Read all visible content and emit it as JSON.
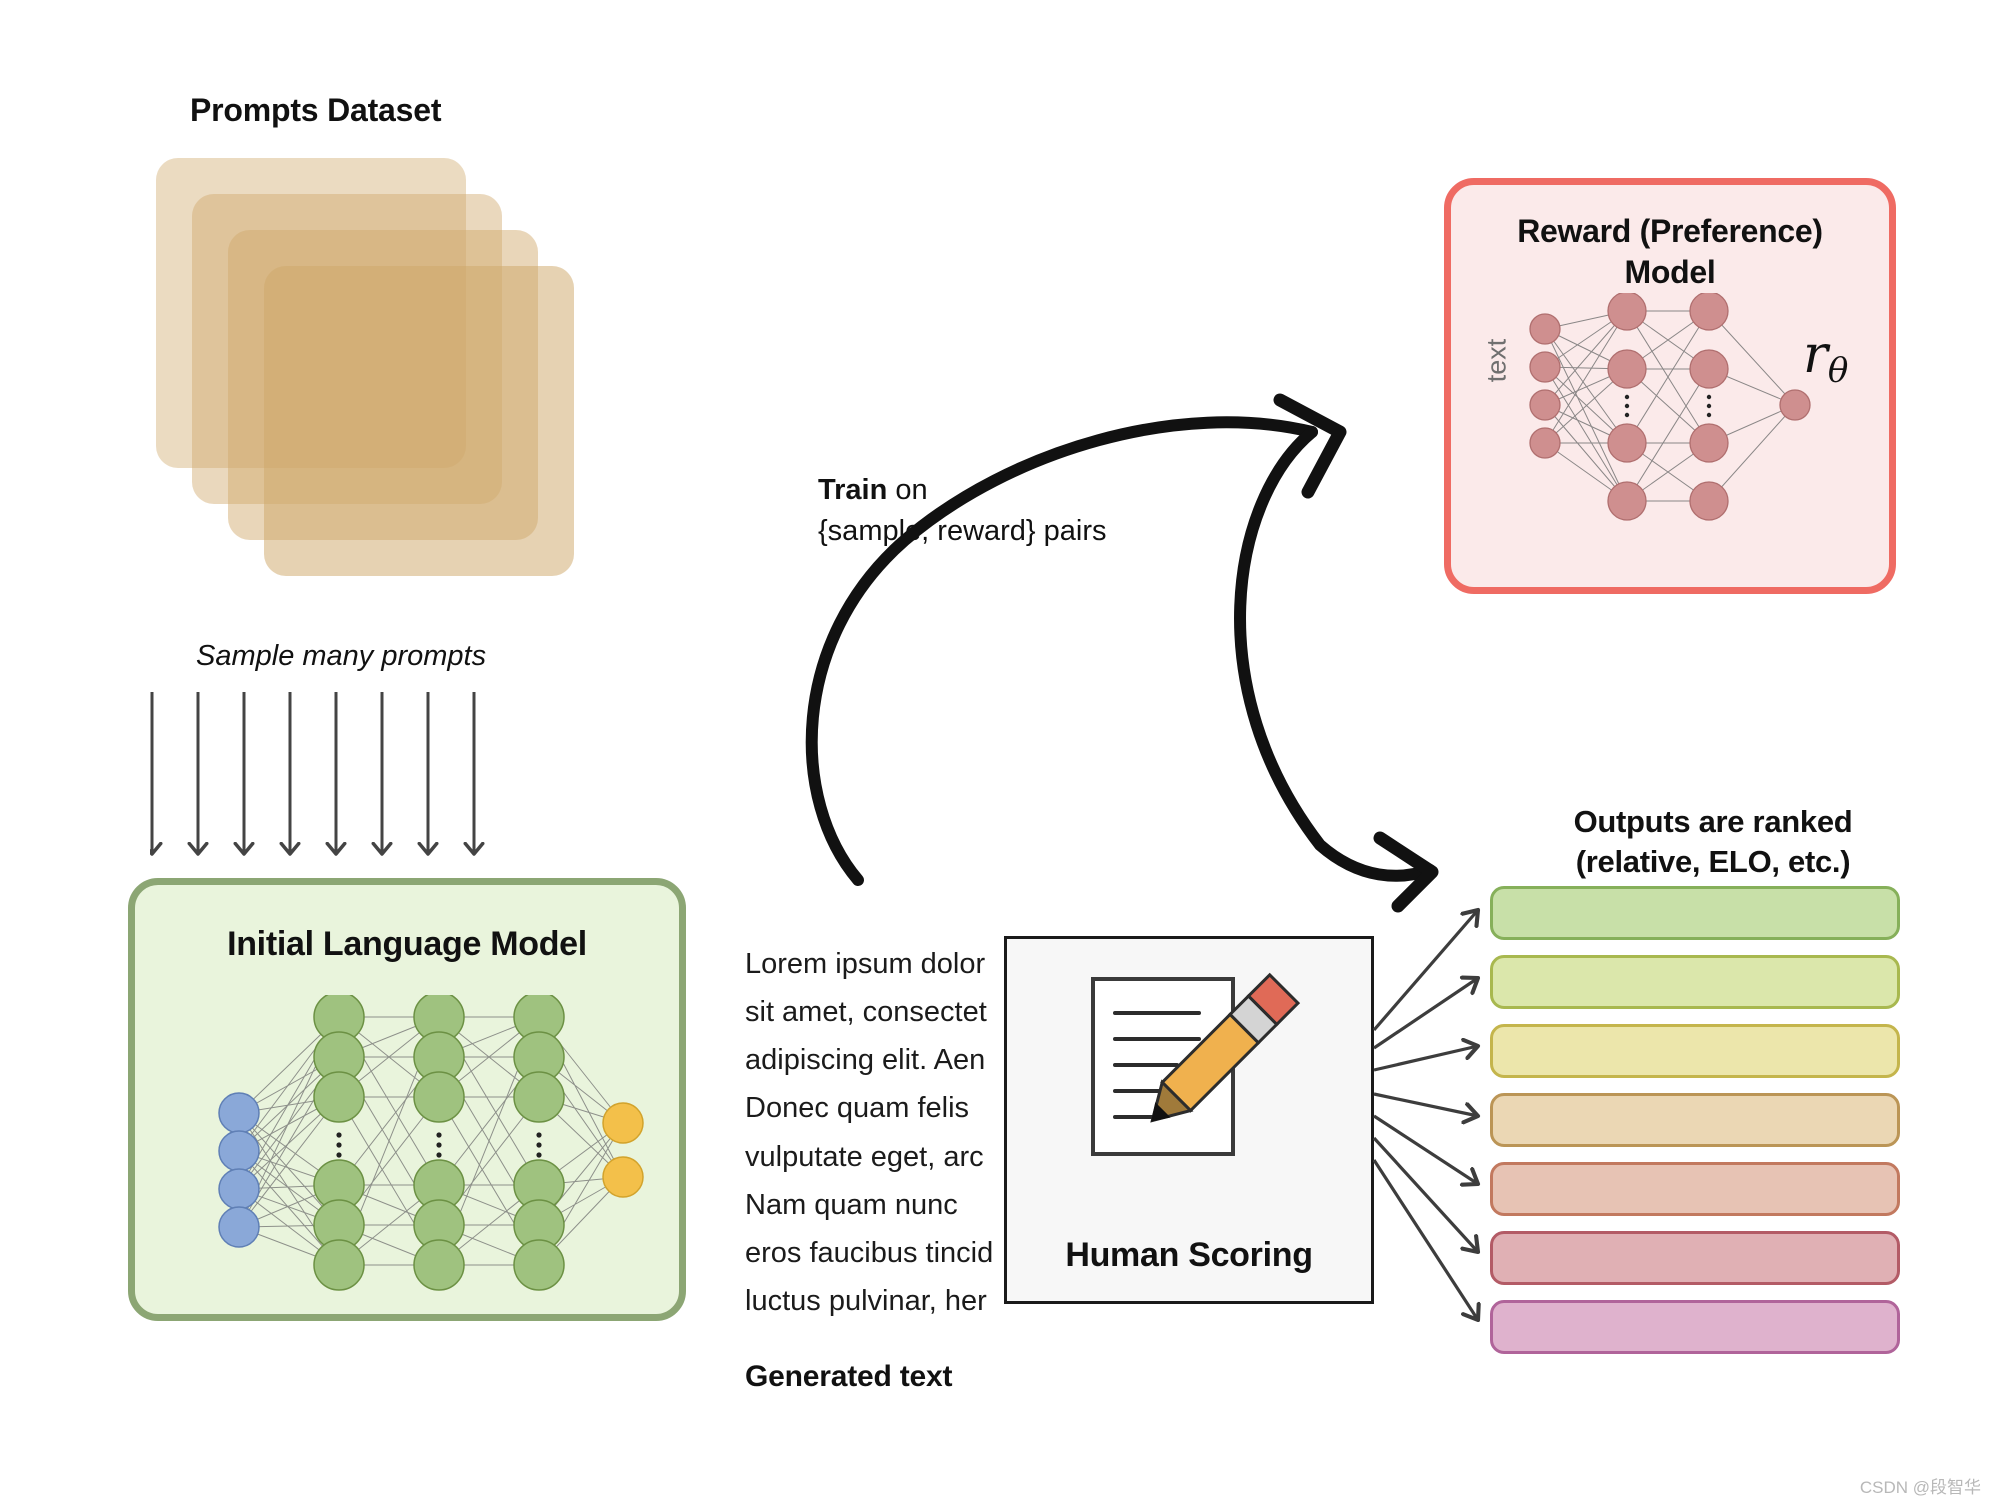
{
  "prompts": {
    "title": "Prompts Dataset",
    "card_color": "#d0a96c",
    "card_count": 4,
    "sample_caption": "Sample many prompts",
    "arrow_count": 8
  },
  "initial_model": {
    "title": "Initial Language Model",
    "fill_color": "#e9f4dc",
    "border_color": "#8ca674",
    "network": {
      "input_node_color": "#8aa8d8",
      "hidden_node_color": "#9fc27f",
      "output_node_color": "#f3c04a",
      "input_nodes": 4,
      "hidden_layers": 3,
      "hidden_nodes_per_layer": 6,
      "output_nodes": 2,
      "ellipsis_glyph": "⋮"
    }
  },
  "train_arrow": {
    "label_bold": "Train",
    "label_rest": " on",
    "label_line2": "{sample, reward} pairs"
  },
  "reward_model": {
    "title_line1": "Reward (Preference)",
    "title_line2": "Model",
    "fill_color": "#fbeaea",
    "border_color": "#ef6b63",
    "input_label": "text",
    "output_symbol": "r",
    "output_subscript": "θ",
    "network": {
      "node_color": "#cf8f8f",
      "input_nodes": 4,
      "hidden_layers": 2,
      "hidden_nodes_per_layer": 4,
      "output_nodes": 1,
      "ellipsis_glyph": "⋮"
    }
  },
  "generated": {
    "label": "Generated text",
    "lines": [
      "Lorem ipsum dolor",
      "sit amet, consectet",
      "adipiscing elit. Aen",
      "Donec quam felis",
      "vulputate eget, arc",
      "Nam quam nunc",
      "eros faucibus tincid",
      "luctus pulvinar, her"
    ]
  },
  "human_scoring": {
    "label": "Human Scoring",
    "icon": "document-with-pencil-icon",
    "pencil_body_color": "#f0b14e",
    "pencil_eraser_color": "#e06a57",
    "pencil_ferrule_color": "#d4d4d4",
    "panel_bg": "#f7f7f7",
    "panel_border": "#1a1a1a"
  },
  "ranked_outputs": {
    "title_line1": "Outputs are ranked",
    "title_line2": "(relative, ELO, etc.)",
    "bars": [
      {
        "fill": "#c8e0a8",
        "border": "#86b05a"
      },
      {
        "fill": "#dbe7ab",
        "border": "#a8b84f"
      },
      {
        "fill": "#ece6ab",
        "border": "#c4b54c"
      },
      {
        "fill": "#ebd7b4",
        "border": "#bb9556"
      },
      {
        "fill": "#e7c3b4",
        "border": "#c2795f"
      },
      {
        "fill": "#e0b0b4",
        "border": "#b35b66"
      },
      {
        "fill": "#dfb2cd",
        "border": "#b0649a"
      }
    ],
    "connector_arrow_count": 7
  },
  "watermark": "CSDN @段智华"
}
